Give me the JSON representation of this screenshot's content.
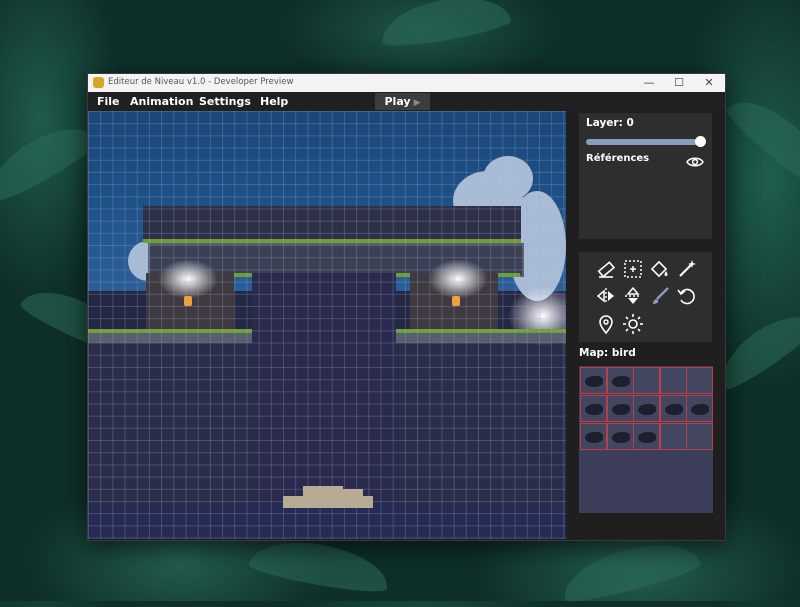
{
  "window": {
    "title": "Editeur de Niveau v1.0 - Developer Preview",
    "controls": {
      "minimize": "—",
      "maximize": "☐",
      "close": "✕"
    }
  },
  "menu": {
    "file": "File",
    "animation": "Animation",
    "settings": "Settings",
    "help": "Help",
    "play": "Play",
    "play_icon": "▶"
  },
  "layer_panel": {
    "layer_label": "Layer: 0",
    "layer_slider_value": 1.0,
    "references_label": "Références",
    "visibility_icon": "eye-icon"
  },
  "tools": [
    {
      "name": "eraser-icon"
    },
    {
      "name": "selection-icon"
    },
    {
      "name": "fill-icon"
    },
    {
      "name": "magic-wand-icon"
    },
    {
      "name": "flip-horizontal-icon"
    },
    {
      "name": "flip-vertical-icon"
    },
    {
      "name": "brush-icon",
      "active": true
    },
    {
      "name": "undo-icon"
    },
    {
      "name": "location-pin-icon"
    },
    {
      "name": "light-icon"
    }
  ],
  "map": {
    "label": "Map: bird",
    "rows": 3,
    "cols": 5,
    "filled_cells": [
      [
        0,
        0
      ],
      [
        0,
        1
      ],
      [
        1,
        0
      ],
      [
        1,
        1
      ],
      [
        1,
        2
      ],
      [
        1,
        3
      ],
      [
        1,
        4
      ],
      [
        2,
        0
      ],
      [
        2,
        1
      ],
      [
        2,
        2
      ]
    ]
  },
  "colors": {
    "accent_grid": "#c23b4a",
    "panel": "#2e2e2e",
    "slider": "#8c9bc0"
  }
}
